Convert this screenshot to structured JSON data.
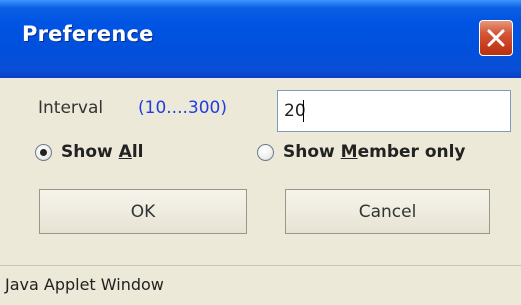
{
  "window": {
    "title": "Preference",
    "close_icon": "close-icon"
  },
  "form": {
    "interval_label": "Interval",
    "interval_range": "(10....300)",
    "interval_value": "20",
    "radio_options": [
      {
        "label_prefix": "Show ",
        "mnemonic": "A",
        "label_suffix": "ll",
        "selected": true
      },
      {
        "label_prefix": "Show ",
        "mnemonic": "M",
        "label_suffix": "ember only",
        "selected": false
      }
    ]
  },
  "buttons": {
    "ok_label": "OK",
    "cancel_label": "Cancel"
  },
  "status_bar": {
    "text": "Java Applet Window"
  },
  "colors": {
    "title_bar": "#0054e3",
    "close_button": "#c73f1f",
    "range_text": "#1f3de0",
    "window_background": "#ece9d8"
  }
}
